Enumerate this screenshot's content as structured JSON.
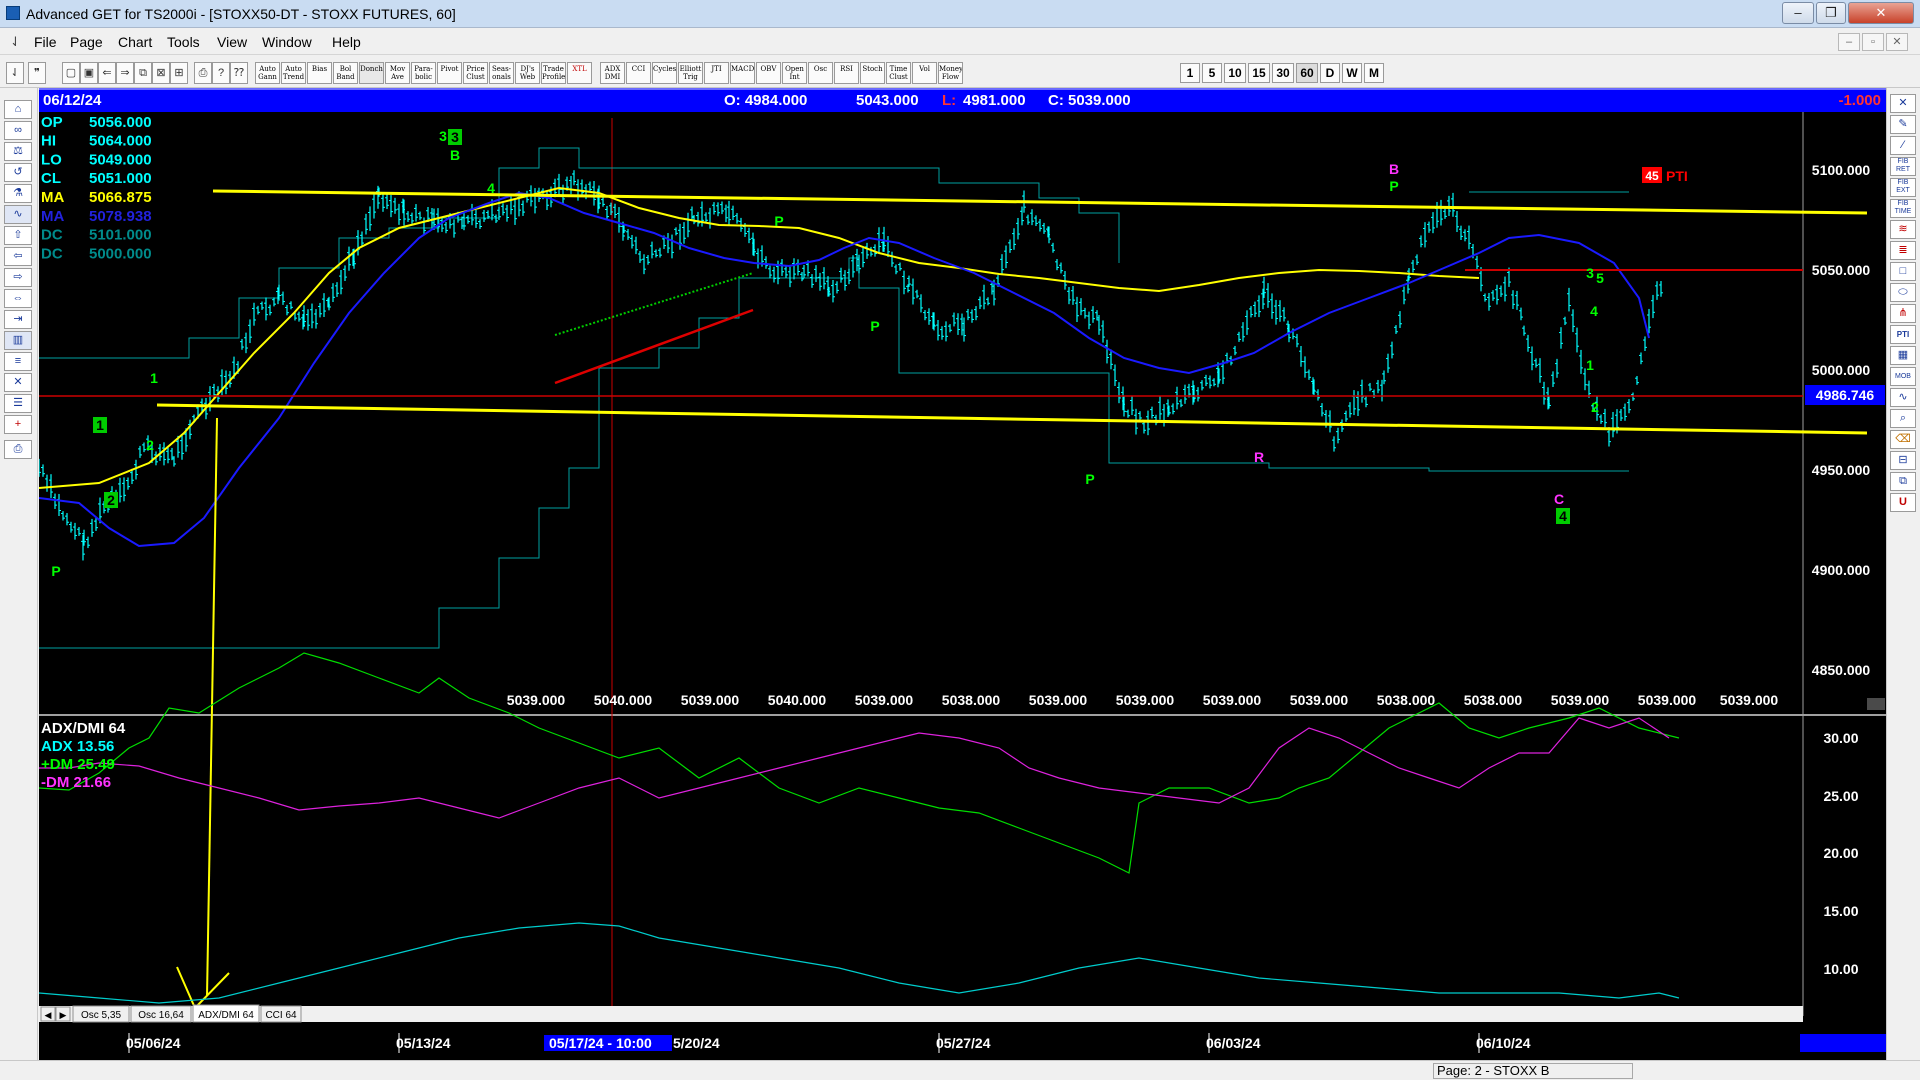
{
  "window": {
    "title": "Advanced GET for TS2000i - [STOXX50-DT - STOXX FUTURES, 60]",
    "minimize": "–",
    "maximize": "❐",
    "close": "✕"
  },
  "menu": {
    "items": [
      "File",
      "Page",
      "Chart",
      "Tools",
      "View",
      "Window",
      "Help"
    ],
    "mdi_min": "–",
    "mdi_restore": "▫",
    "mdi_close": "✕"
  },
  "toolbar": {
    "studies": [
      "Auto Gann",
      "Auto Trend",
      "Bias",
      "Bol Band",
      "Donch",
      "Mov Ave",
      "Para-bolic",
      "Pivot",
      "Price Clust",
      "Seas-onals",
      "DJ's Web",
      "Trade Profile",
      "XTL",
      "ADX DMI",
      "CCI",
      "Cycles",
      "Elliott Trig",
      "JTI",
      "MACD",
      "OBV",
      "Open Int",
      "Osc",
      "RSI",
      "Stoch",
      "Time Clust",
      "Vol",
      "Money Flow"
    ],
    "periods": [
      "1",
      "5",
      "10",
      "15",
      "30",
      "60",
      "D",
      "W",
      "M"
    ],
    "selected_period": "60"
  },
  "header": {
    "date": "06/12/24",
    "open": "O: 4984.000",
    "high": "5043.000",
    "low_label": "L:",
    "low": "4981.000",
    "close": "C: 5039.000",
    "change": "-1.000"
  },
  "price_legend": [
    {
      "label": "OP",
      "value": "5056.000",
      "color": "#00ffff"
    },
    {
      "label": "HI",
      "value": "5064.000",
      "color": "#00ffff"
    },
    {
      "label": "LO",
      "value": "5049.000",
      "color": "#00ffff"
    },
    {
      "label": "CL",
      "value": "5051.000",
      "color": "#00ffff"
    },
    {
      "label": "MA",
      "value": "5066.875",
      "color": "#ffff00"
    },
    {
      "label": "MA",
      "value": "5078.938",
      "color": "#2222dd"
    },
    {
      "label": "DC",
      "value": "5101.000",
      "color": "#008b8b"
    },
    {
      "label": "DC",
      "value": "5000.000",
      "color": "#008b8b"
    }
  ],
  "price_axis": {
    "labels": [
      "5100.000",
      "5050.000",
      "5000.000",
      "4950.000",
      "4900.000",
      "4850.000"
    ],
    "current": "4986.746"
  },
  "bottom_values": [
    "5039.000",
    "5040.000",
    "5039.000",
    "5040.000",
    "5039.000",
    "5038.000",
    "5039.000",
    "5039.000",
    "5039.000",
    "5039.000",
    "5038.000",
    "5038.000",
    "5039.000",
    "5039.000",
    "5039.000"
  ],
  "pti": {
    "number": "45",
    "label": "PTI"
  },
  "wave_labels": [
    {
      "text": "P",
      "color": "#00ff00"
    },
    {
      "text": "1",
      "color": "#00ff00",
      "boxed": true
    },
    {
      "text": "2",
      "color": "#00ff00",
      "boxed": true
    },
    {
      "text": "1",
      "color": "#00ff00"
    },
    {
      "text": "2",
      "color": "#00ff00"
    },
    {
      "text": "3",
      "color": "#00ff00"
    },
    {
      "text": "3",
      "color": "#00ff00",
      "boxed": true
    },
    {
      "text": "B",
      "color": "#00ff00"
    },
    {
      "text": "4",
      "color": "#00ff00"
    },
    {
      "text": "P",
      "color": "#00ff00"
    },
    {
      "text": "P",
      "color": "#00ff00"
    },
    {
      "text": "P",
      "color": "#00ff00"
    },
    {
      "text": "R",
      "color": "#ff33ff"
    },
    {
      "text": "B",
      "color": "#ff33ff"
    },
    {
      "text": "P",
      "color": "#00ff00"
    },
    {
      "text": "3",
      "color": "#00ff00"
    },
    {
      "text": "5",
      "color": "#00ff00"
    },
    {
      "text": "4",
      "color": "#00ff00"
    },
    {
      "text": "1",
      "color": "#00ff00"
    },
    {
      "text": "2",
      "color": "#00ff00"
    },
    {
      "text": "C",
      "color": "#ff33ff"
    },
    {
      "text": "4",
      "color": "#00ff00",
      "boxed": true
    }
  ],
  "indicator": {
    "title": "ADX/DMI 64",
    "lines": [
      {
        "label": "ADX",
        "value": "13.56",
        "color": "#00ffff"
      },
      {
        "label": "+DM",
        "value": "25.49",
        "color": "#00ff00"
      },
      {
        "label": "-DM",
        "value": "21.66",
        "color": "#ff33ff"
      }
    ],
    "axis": [
      "30.00",
      "25.00",
      "20.00",
      "15.00",
      "10.00"
    ]
  },
  "tabs": [
    "Osc 5,35",
    "Osc 16,64",
    "ADX/DMI 64",
    "CCI 64"
  ],
  "date_axis": {
    "labels": [
      "05/06/24",
      "05/13/24",
      "5/20/24",
      "05/27/24",
      "06/03/24",
      "06/10/24"
    ],
    "cursor": "05/17/24 - 10:00"
  },
  "status": {
    "page": "Page: 2 - STOXX B"
  }
}
